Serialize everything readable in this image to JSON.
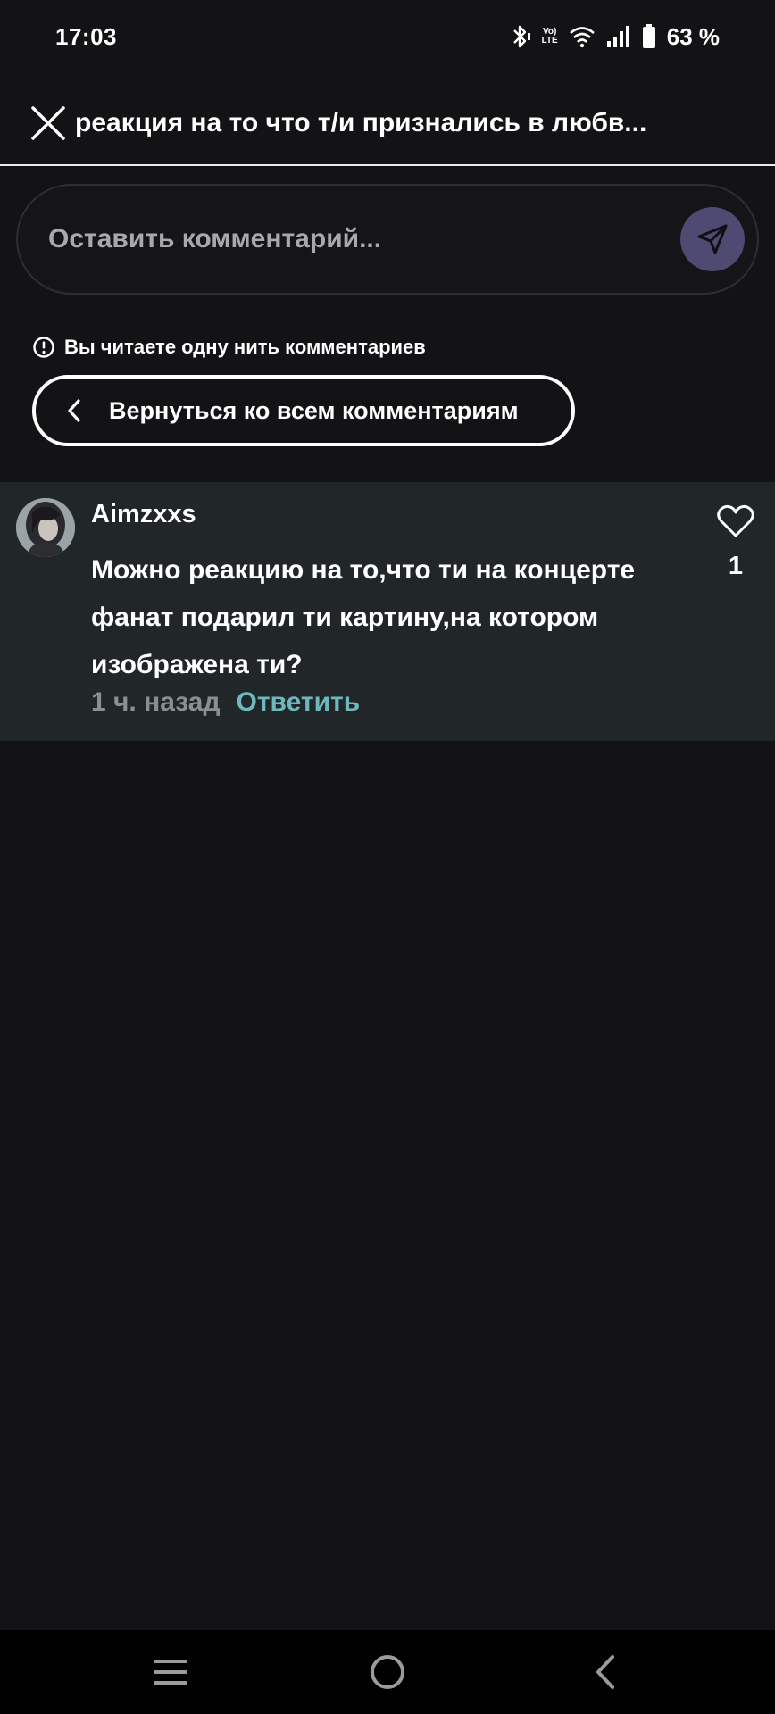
{
  "status_bar": {
    "time": "17:03",
    "network_label_top": "Vo)",
    "network_label_bottom": "LTE",
    "battery_percent": "63 %",
    "icons": [
      "bluetooth-icon",
      "volte-icon",
      "wifi-icon",
      "signal-icon",
      "battery-icon"
    ]
  },
  "header": {
    "title": "реакция на то что т/и признались в любв...",
    "close_icon": "close-icon"
  },
  "comment_input": {
    "placeholder": "Оставить комментарий...",
    "send_icon": "send-icon",
    "send_color": "#4f4a72"
  },
  "thread_notice": {
    "text": "Вы читаете одну нить комментариев",
    "icon": "info-icon"
  },
  "back_button": {
    "label": "Вернуться ко всем комментариям",
    "icon": "chevron-left-icon"
  },
  "comment": {
    "username": "Aimzxxs",
    "text": "Можно реакцию на то,что ти на концерте фанат подарил ти картину,на котором изображена ти?",
    "time": "1 ч. назад",
    "reply_label": "Ответить",
    "reply_color": "#6eb8bd",
    "like_count": "1",
    "like_icon": "heart-icon"
  },
  "nav_bar": {
    "buttons": [
      "menu-icon",
      "home-icon",
      "back-icon"
    ]
  }
}
